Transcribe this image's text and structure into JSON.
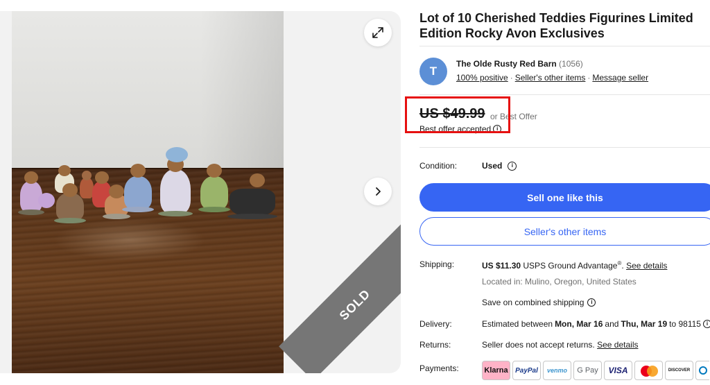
{
  "listing": {
    "title": "Lot of 10 Cherished Teddies Figurines Limited Edition Rocky Avon Exclusives",
    "sold_badge": "SOLD"
  },
  "seller": {
    "avatar_letter": "T",
    "name": "The Olde Rusty Red Barn",
    "feedback_count": "(1056)",
    "positive": "100% positive",
    "other_items_link": "Seller's other items",
    "message_link": "Message seller"
  },
  "price": {
    "amount": "US $49.99",
    "best_offer": "or Best Offer",
    "accepted": "Best offer accepted"
  },
  "condition": {
    "label": "Condition:",
    "value": "Used"
  },
  "buttons": {
    "sell_one": "Sell one like this",
    "sellers_other_items": "Seller's other items"
  },
  "shipping": {
    "label": "Shipping:",
    "price": "US $11.30",
    "service": "USPS Ground Advantage",
    "reg": "®",
    "see_details": "See details",
    "located": "Located in: Mulino, Oregon, United States",
    "combined": "Save on combined shipping"
  },
  "delivery": {
    "label": "Delivery:",
    "text_start": "Estimated between",
    "date1": "Mon, Mar 16",
    "and": "and",
    "date2": "Thu, Mar 19",
    "to": "to 98115"
  },
  "returns": {
    "label": "Returns:",
    "text": "Seller does not accept returns.",
    "see_details": "See details"
  },
  "payments": {
    "label": "Payments:",
    "methods": [
      "Klarna",
      "PayPal",
      "venmo",
      "G Pay",
      "VISA",
      "",
      "DISCOVER"
    ]
  },
  "colors": {
    "primary": "#3665f3",
    "highlight_box": "#e61010",
    "sold_band": "#767676"
  }
}
